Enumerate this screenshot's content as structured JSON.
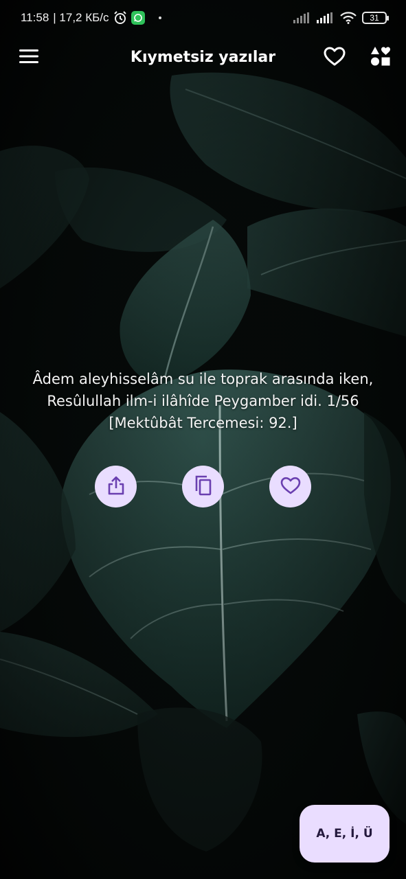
{
  "status_bar": {
    "time": "11:58",
    "speed": "| 17,2 КБ/с",
    "battery": "31",
    "icons": [
      "alarm-icon",
      "whatsapp-icon",
      "notification-dot",
      "cell-signal-icon",
      "cell-signal-icon",
      "wifi-icon",
      "battery-icon"
    ]
  },
  "app_bar": {
    "title": "Kıymetsiz yazılar",
    "menu_icon": "menu-icon",
    "favorites_icon": "heart-icon",
    "categories_icon": "shapes-icon"
  },
  "quote": {
    "line1": "Âdem aleyhisselâm su ile toprak arasında iken,",
    "line2": "Resûlullah ilm-i ilâhîde Peygamber idi. 1/56",
    "line3": "[Mektûbât Tercemesi: 92.]"
  },
  "actions": [
    {
      "icon": "share-icon"
    },
    {
      "icon": "copy-icon"
    },
    {
      "icon": "heart-icon"
    }
  ],
  "fab": {
    "label": "A, E, İ, Ü"
  },
  "colors": {
    "accent": "#eaddff",
    "icon_purple": "#6a3fb0",
    "background": "#050807",
    "leaf": "#1f3b36"
  }
}
